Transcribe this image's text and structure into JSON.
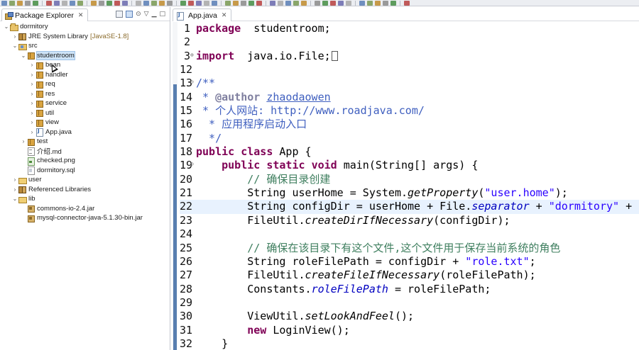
{
  "colors": {
    "keyword": "#7f0055",
    "string": "#2a00ff",
    "comment": "#3f7f5f",
    "javadoc": "#3f5fbf",
    "field": "#0000c0",
    "selection": "#cde3f7",
    "current_line": "#e8f2fe"
  },
  "explorer": {
    "tab_title": "Package Explorer",
    "close_glyph": "✕",
    "tree": [
      {
        "label": "dormitory",
        "depth": 0,
        "twisty": "v",
        "icon": "project-icon"
      },
      {
        "label": "JRE System Library",
        "deco": "[JavaSE-1.8]",
        "depth": 1,
        "twisty": ">",
        "icon": "library-icon"
      },
      {
        "label": "src",
        "depth": 1,
        "twisty": "v",
        "icon": "source-folder-icon"
      },
      {
        "label": "studentroom",
        "depth": 2,
        "twisty": "v",
        "icon": "package-icon",
        "selected": true
      },
      {
        "label": "bean",
        "depth": 3,
        "twisty": ">",
        "icon": "package-icon"
      },
      {
        "label": "handler",
        "depth": 3,
        "twisty": ">",
        "icon": "package-icon"
      },
      {
        "label": "req",
        "depth": 3,
        "twisty": ">",
        "icon": "package-icon"
      },
      {
        "label": "res",
        "depth": 3,
        "twisty": ">",
        "icon": "package-icon"
      },
      {
        "label": "service",
        "depth": 3,
        "twisty": ">",
        "icon": "package-icon"
      },
      {
        "label": "util",
        "depth": 3,
        "twisty": ">",
        "icon": "package-icon"
      },
      {
        "label": "view",
        "depth": 3,
        "twisty": ">",
        "icon": "package-icon"
      },
      {
        "label": "App.java",
        "depth": 3,
        "twisty": ">",
        "icon": "java-file-icon"
      },
      {
        "label": "test",
        "depth": 2,
        "twisty": ">",
        "icon": "package-icon"
      },
      {
        "label": "介绍.md",
        "depth": 2,
        "twisty": "",
        "icon": "text-file-icon"
      },
      {
        "label": "checked.png",
        "depth": 2,
        "twisty": "",
        "icon": "image-file-icon"
      },
      {
        "label": "dormitory.sql",
        "depth": 2,
        "twisty": "",
        "icon": "sql-file-icon"
      },
      {
        "label": "user",
        "depth": 1,
        "twisty": ">",
        "icon": "folder-icon"
      },
      {
        "label": "Referenced Libraries",
        "depth": 1,
        "twisty": ">",
        "icon": "library-icon"
      },
      {
        "label": "lib",
        "depth": 1,
        "twisty": "v",
        "icon": "folder-icon"
      },
      {
        "label": "commons-io-2.4.jar",
        "depth": 2,
        "twisty": "",
        "icon": "jar-icon"
      },
      {
        "label": "mysql-connector-java-5.1.30-bin.jar",
        "depth": 2,
        "twisty": "",
        "icon": "jar-icon"
      }
    ]
  },
  "editor": {
    "tab_title": "App.java",
    "close_glyph": "✕",
    "lines": [
      {
        "n": "1",
        "tokens": [
          [
            "kw",
            "package"
          ],
          [
            "",
            "  studentroom;"
          ]
        ]
      },
      {
        "n": "2",
        "tokens": []
      },
      {
        "n": "3",
        "fold": "⊕",
        "warn": true,
        "tokens": [
          [
            "kw",
            "import"
          ],
          [
            "",
            "  java.io.File;"
          ],
          [
            "box",
            ""
          ]
        ]
      },
      {
        "n": "12",
        "tokens": []
      },
      {
        "n": "13",
        "fold": "⊖",
        "tokens": [
          [
            "doc",
            "/**"
          ]
        ]
      },
      {
        "n": "14",
        "tokens": [
          [
            "doc",
            " * "
          ],
          [
            "tag",
            "@author"
          ],
          [
            "doc",
            " "
          ],
          [
            "docu",
            "zhaodaowen"
          ]
        ]
      },
      {
        "n": "15",
        "tokens": [
          [
            "doc",
            " * 个人网站: http://www.roadjava.com/"
          ]
        ]
      },
      {
        "n": "16",
        "tokens": [
          [
            "doc",
            "  * 应用程序启动入口"
          ]
        ]
      },
      {
        "n": "17",
        "tokens": [
          [
            "doc",
            "  */"
          ]
        ]
      },
      {
        "n": "18",
        "tokens": [
          [
            "kw",
            "public"
          ],
          [
            "",
            " "
          ],
          [
            "kw",
            "class"
          ],
          [
            "",
            " App {"
          ]
        ]
      },
      {
        "n": "19",
        "fold": "⊖",
        "tokens": [
          [
            "",
            "    "
          ],
          [
            "kw",
            "public"
          ],
          [
            "",
            " "
          ],
          [
            "kw",
            "static"
          ],
          [
            "",
            " "
          ],
          [
            "kw",
            "void"
          ],
          [
            "",
            " main(String[] args) {"
          ]
        ]
      },
      {
        "n": "20",
        "tokens": [
          [
            "",
            "        "
          ],
          [
            "cm",
            "// 确保目录创建"
          ]
        ]
      },
      {
        "n": "21",
        "tokens": [
          [
            "",
            "        String userHome = System."
          ],
          [
            "static",
            "getProperty"
          ],
          [
            "",
            "("
          ],
          [
            "str",
            "\"user.home\""
          ],
          [
            "",
            ");"
          ]
        ]
      },
      {
        "n": "22",
        "highlight": true,
        "tokens": [
          [
            "",
            "        String configDir = userHome + File."
          ],
          [
            "field",
            "separator"
          ],
          [
            "",
            " + "
          ],
          [
            "str",
            "\"dormitory\""
          ],
          [
            "",
            " + Fi"
          ]
        ]
      },
      {
        "n": "23",
        "tokens": [
          [
            "",
            "        FileUtil."
          ],
          [
            "static",
            "createDirIfNecessary"
          ],
          [
            "",
            "(configDir);"
          ]
        ]
      },
      {
        "n": "24",
        "tokens": []
      },
      {
        "n": "25",
        "tokens": [
          [
            "",
            "        "
          ],
          [
            "cm",
            "// 确保在该目录下有这个文件,这个文件用于保存当前系统的角色"
          ]
        ]
      },
      {
        "n": "26",
        "tokens": [
          [
            "",
            "        String roleFilePath = configDir + "
          ],
          [
            "str",
            "\"role.txt\""
          ],
          [
            "",
            ";"
          ]
        ]
      },
      {
        "n": "27",
        "tokens": [
          [
            "",
            "        FileUtil."
          ],
          [
            "static",
            "createFileIfNecessary"
          ],
          [
            "",
            "(roleFilePath);"
          ]
        ]
      },
      {
        "n": "28",
        "tokens": [
          [
            "",
            "        Constants."
          ],
          [
            "field",
            "roleFilePath"
          ],
          [
            "",
            " = roleFilePath;"
          ]
        ]
      },
      {
        "n": "29",
        "tokens": []
      },
      {
        "n": "30",
        "tokens": [
          [
            "",
            "        ViewUtil."
          ],
          [
            "static",
            "setLookAndFeel"
          ],
          [
            "",
            "();"
          ]
        ]
      },
      {
        "n": "31",
        "tokens": [
          [
            "",
            "        "
          ],
          [
            "kw",
            "new"
          ],
          [
            "",
            " LoginView();"
          ]
        ]
      },
      {
        "n": "32",
        "tokens": [
          [
            "",
            "    }"
          ]
        ]
      }
    ]
  }
}
